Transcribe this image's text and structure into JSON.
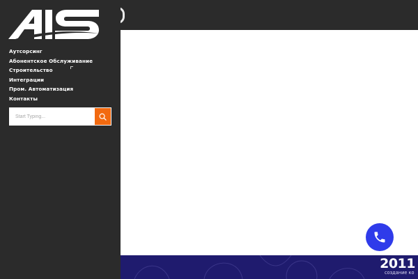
{
  "brand": {
    "logo_text": "AIS",
    "logo_icon": "ais-logo"
  },
  "menu": {
    "items": [
      {
        "label": "Аутсорсинг"
      },
      {
        "label": "Абонентское Обслуживание"
      },
      {
        "label": "Строительство",
        "has_submenu": true
      },
      {
        "label": "Интеграции"
      },
      {
        "label": "Пром. Автоматизация"
      },
      {
        "label": "Контакты"
      }
    ]
  },
  "search": {
    "placeholder": "Start Typing...",
    "value": "",
    "button_icon": "search-icon"
  },
  "banner": {
    "year": "2011",
    "caption": "создание ко"
  },
  "call_button": {
    "icon": "phone-icon"
  },
  "colors": {
    "sidebar_bg": "#2b2b2b",
    "accent_orange": "#f26a10",
    "band_purple": "#1f1b6e",
    "call_blue": "#2f3bea",
    "text_white": "#ffffff"
  }
}
